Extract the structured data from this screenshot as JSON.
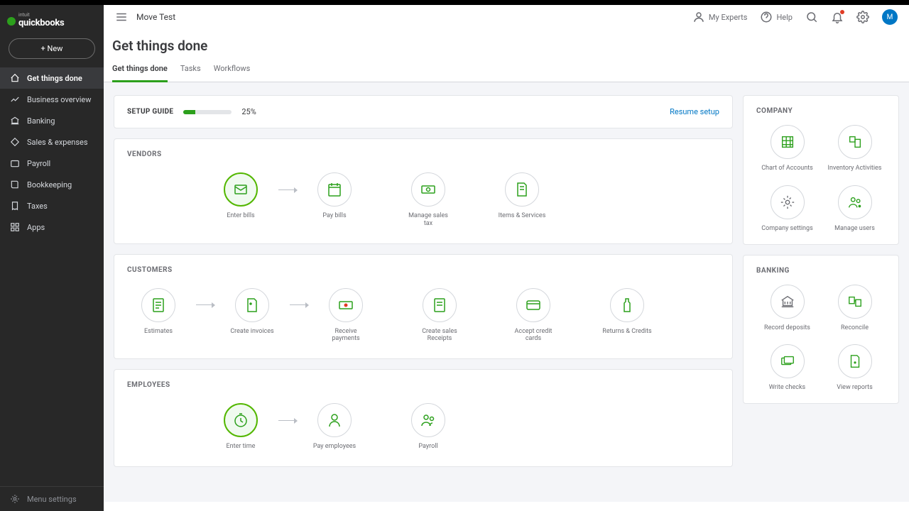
{
  "brand": {
    "name": "quickbooks",
    "prefix": "intuit"
  },
  "topbar": {
    "company": "Move Test",
    "experts": "My Experts",
    "help": "Help",
    "avatar_letter": "M"
  },
  "sidebar": {
    "new_label": "+   New",
    "items": [
      {
        "label": "Get things done"
      },
      {
        "label": "Business overview"
      },
      {
        "label": "Banking"
      },
      {
        "label": "Sales & expenses"
      },
      {
        "label": "Payroll"
      },
      {
        "label": "Bookkeeping"
      },
      {
        "label": "Taxes"
      },
      {
        "label": "Apps"
      }
    ],
    "bottom": "Menu settings"
  },
  "page": {
    "title": "Get things done"
  },
  "tabs": [
    {
      "label": "Get things done"
    },
    {
      "label": "Tasks"
    },
    {
      "label": "Workflows"
    }
  ],
  "setup": {
    "label": "SETUP GUIDE",
    "percent": "25%",
    "resume": "Resume setup"
  },
  "sections": {
    "vendors": {
      "title": "VENDORS",
      "items": [
        {
          "label": "Enter bills"
        },
        {
          "label": "Pay bills"
        },
        {
          "label": "Manage sales tax"
        },
        {
          "label": "Items & Services"
        }
      ]
    },
    "customers": {
      "title": "CUSTOMERS",
      "items": [
        {
          "label": "Estimates"
        },
        {
          "label": "Create invoices"
        },
        {
          "label": "Receive payments"
        },
        {
          "label": "Create sales Receipts"
        },
        {
          "label": "Accept credit cards"
        },
        {
          "label": "Returns & Credits"
        }
      ]
    },
    "employees": {
      "title": "EMPLOYEES",
      "items": [
        {
          "label": "Enter time"
        },
        {
          "label": "Pay employees"
        },
        {
          "label": "Payroll"
        }
      ]
    },
    "company": {
      "title": "COMPANY",
      "items": [
        {
          "label": "Chart of Accounts"
        },
        {
          "label": "Inventory Activities"
        },
        {
          "label": "Company settings"
        },
        {
          "label": "Manage users"
        }
      ]
    },
    "banking": {
      "title": "BANKING",
      "items": [
        {
          "label": "Record deposits"
        },
        {
          "label": "Reconcile"
        },
        {
          "label": "Write checks"
        },
        {
          "label": "View reports"
        }
      ]
    }
  }
}
